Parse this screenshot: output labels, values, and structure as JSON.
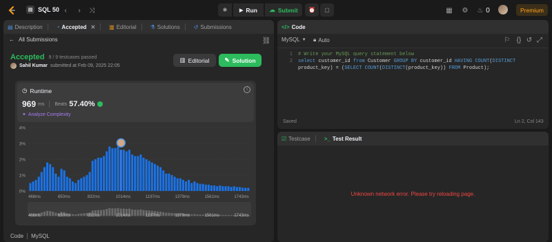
{
  "topbar": {
    "list_title": "SQL 50",
    "run_label": "Run",
    "submit_label": "Submit",
    "streak": "0",
    "premium_label": "Premium"
  },
  "left": {
    "tabs": [
      {
        "label": "Description"
      },
      {
        "label": "Accepted",
        "active": true
      },
      {
        "label": "Editorial"
      },
      {
        "label": "Solutions"
      },
      {
        "label": "Submissions"
      }
    ],
    "back_label": "All Submissions",
    "status": "Accepted",
    "testcases": "9 / 9 testcases passed",
    "author": "Sahil Kumar",
    "submitted_text": "submitted at Feb 09, 2025 22:05",
    "editorial_btn": "Editorial",
    "solution_btn": "Solution",
    "runtime_label": "Runtime",
    "runtime_value": "969",
    "runtime_unit": "ms",
    "beats_label": "Beats",
    "beats_value": "57.40%",
    "analyze_label": "Analyze Complexity",
    "footer_lang": "Code",
    "footer_lang2": "MySQL"
  },
  "chart_data": {
    "type": "bar",
    "ylim": [
      0,
      4
    ],
    "yticks": [
      "4%",
      "3%",
      "2%",
      "1%",
      "0%"
    ],
    "xticks": [
      "468ms",
      "650ms",
      "832ms",
      "1014ms",
      "1197ms",
      "1379ms",
      "1561ms",
      "1743ms"
    ],
    "series": [
      {
        "values": [
          0.5,
          0.6,
          0.7,
          0.9,
          1.2,
          1.5,
          1.8,
          1.7,
          1.5,
          1.1,
          0.9,
          1.4,
          1.3,
          0.9,
          0.8,
          0.6,
          0.5,
          0.7,
          0.8,
          0.9,
          1.0,
          1.2,
          1.9,
          2.0,
          2.1,
          2.1,
          2.2,
          2.5,
          2.8,
          2.7,
          2.7,
          2.8,
          2.6,
          2.6,
          2.5,
          2.6,
          2.3,
          2.2,
          2.2,
          2.3,
          2.1,
          2.0,
          1.9,
          1.8,
          1.7,
          1.6,
          1.5,
          1.3,
          1.1,
          1.1,
          1.0,
          0.9,
          0.8,
          0.8,
          0.7,
          0.6,
          0.7,
          0.5,
          0.6,
          0.5,
          0.45,
          0.45,
          0.4,
          0.4,
          0.35,
          0.35,
          0.3,
          0.35,
          0.3,
          0.3,
          0.3,
          0.25,
          0.3,
          0.25,
          0.25,
          0.2,
          0.2,
          0.2
        ]
      }
    ],
    "highlight_index": 32,
    "mini_xticks": [
      "468ms",
      "650ms",
      "832ms",
      "1014ms",
      "1197ms",
      "1379ms",
      "1561ms",
      "1743ms"
    ]
  },
  "code_panel": {
    "title": "Code",
    "language": "MySQL",
    "auto_label": "Auto",
    "lines": [
      {
        "n": "1",
        "text": "# Write your MySQL query statement below"
      },
      {
        "n": "2",
        "text": "select customer_id from Customer GROUP BY customer_id HAVING COUNT(DISTINCT"
      },
      {
        "n": "",
        "text": "product_key) = (SELECT COUNT(DISTINCT(product_key)) FROM Product);"
      }
    ],
    "saved": "Saved",
    "cursor": "Ln 2, Col 143"
  },
  "result_panel": {
    "tab_testcase": "Testcase",
    "tab_result": "Test Result",
    "error": "Unknown network error. Please try reloading page."
  },
  "colors": {
    "accent_green": "#2cbb5d",
    "bar_blue": "#1a73e8",
    "error_red": "#ef4743",
    "premium": "#ffa116"
  }
}
